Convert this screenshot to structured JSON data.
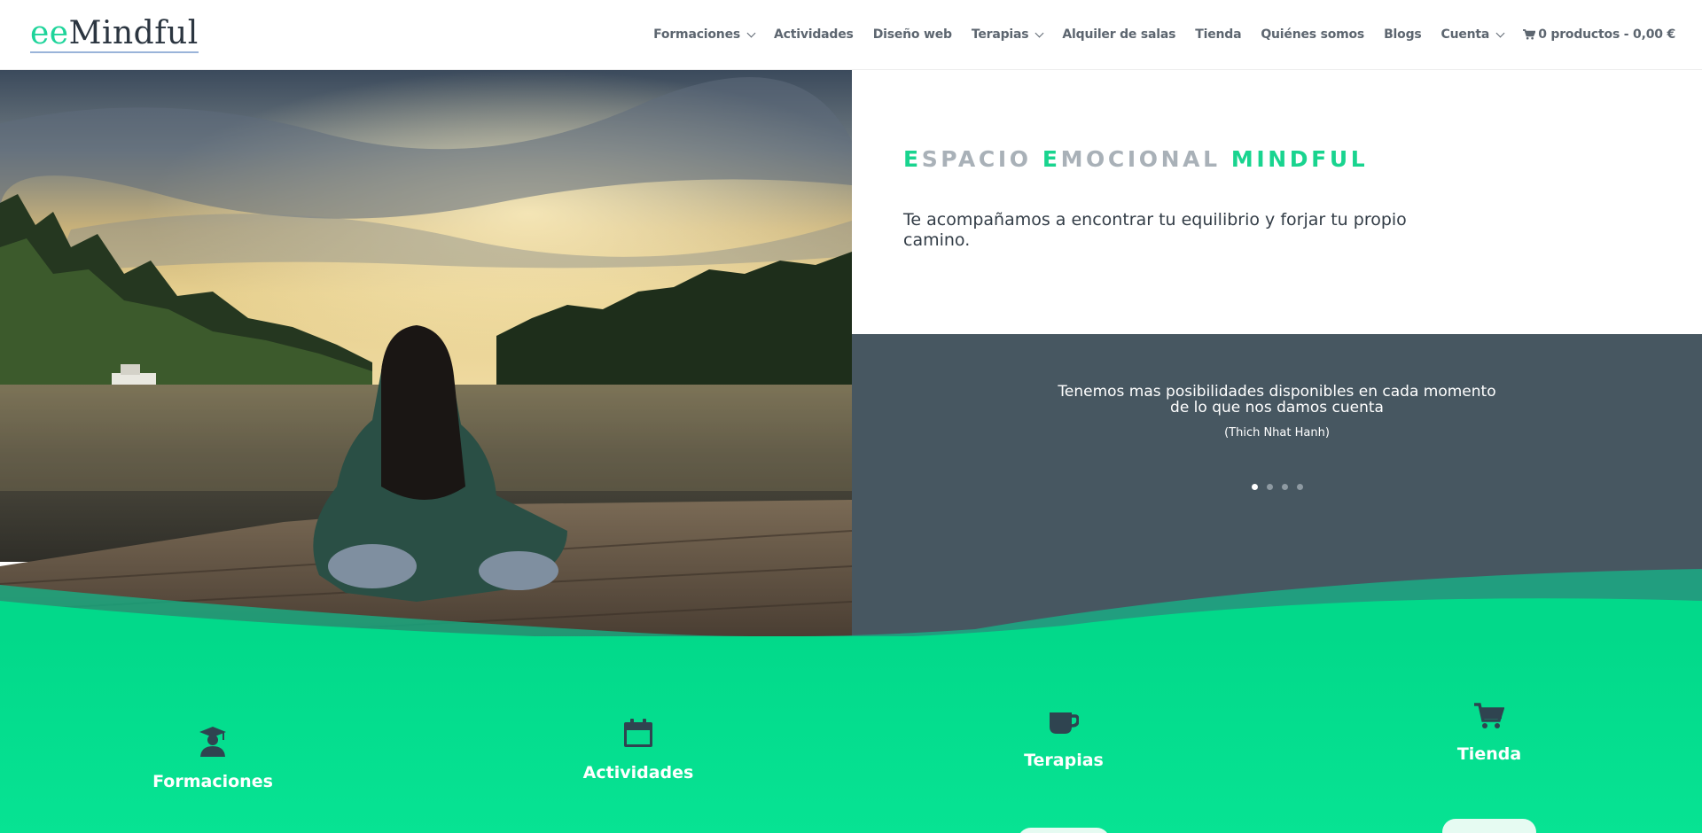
{
  "logo": {
    "prefix": "ee",
    "name": "Mindful"
  },
  "nav": {
    "items": [
      {
        "label": "Formaciones",
        "has_dropdown": true
      },
      {
        "label": "Actividades",
        "has_dropdown": false
      },
      {
        "label": "Diseño web",
        "has_dropdown": false
      },
      {
        "label": "Terapias",
        "has_dropdown": true
      },
      {
        "label": "Alquiler de salas",
        "has_dropdown": false
      },
      {
        "label": "Tienda",
        "has_dropdown": false
      },
      {
        "label": "Quiénes somos",
        "has_dropdown": false
      },
      {
        "label": "Blogs",
        "has_dropdown": false
      },
      {
        "label": "Cuenta",
        "has_dropdown": true
      }
    ],
    "cart": {
      "icon": "cart-icon",
      "label": "0 productos - 0,00 €"
    }
  },
  "hero": {
    "image_description": "meditation-on-dock-photo",
    "tagline": {
      "w1_first": "E",
      "w1_rest": "SPACIO ",
      "w2_first": "E",
      "w2_rest": "MOCIONAL ",
      "w3": "MINDFUL"
    },
    "subtitle": "Te acompañamos a encontrar tu equilibrio y forjar tu propio camino."
  },
  "quote_slider": {
    "text_line1": "Tenemos mas posibilidades disponibles en cada momento",
    "text_line2": "de lo que nos damos cuenta",
    "author": "(Thich Nhat Hanh)",
    "slide_count": 4,
    "active_slide": 1
  },
  "features": [
    {
      "title": "Formaciones",
      "icon": "graduate-icon"
    },
    {
      "title": "Actividades",
      "icon": "calendar-icon"
    },
    {
      "title": "Terapias",
      "icon": "coffee-cup-icon"
    },
    {
      "title": "Tienda",
      "icon": "cart-icon"
    }
  ],
  "colors": {
    "brand_green": "#02d98a",
    "slate": "#475761",
    "icon_dark": "#2f4450",
    "nav_text": "#5d6670"
  }
}
